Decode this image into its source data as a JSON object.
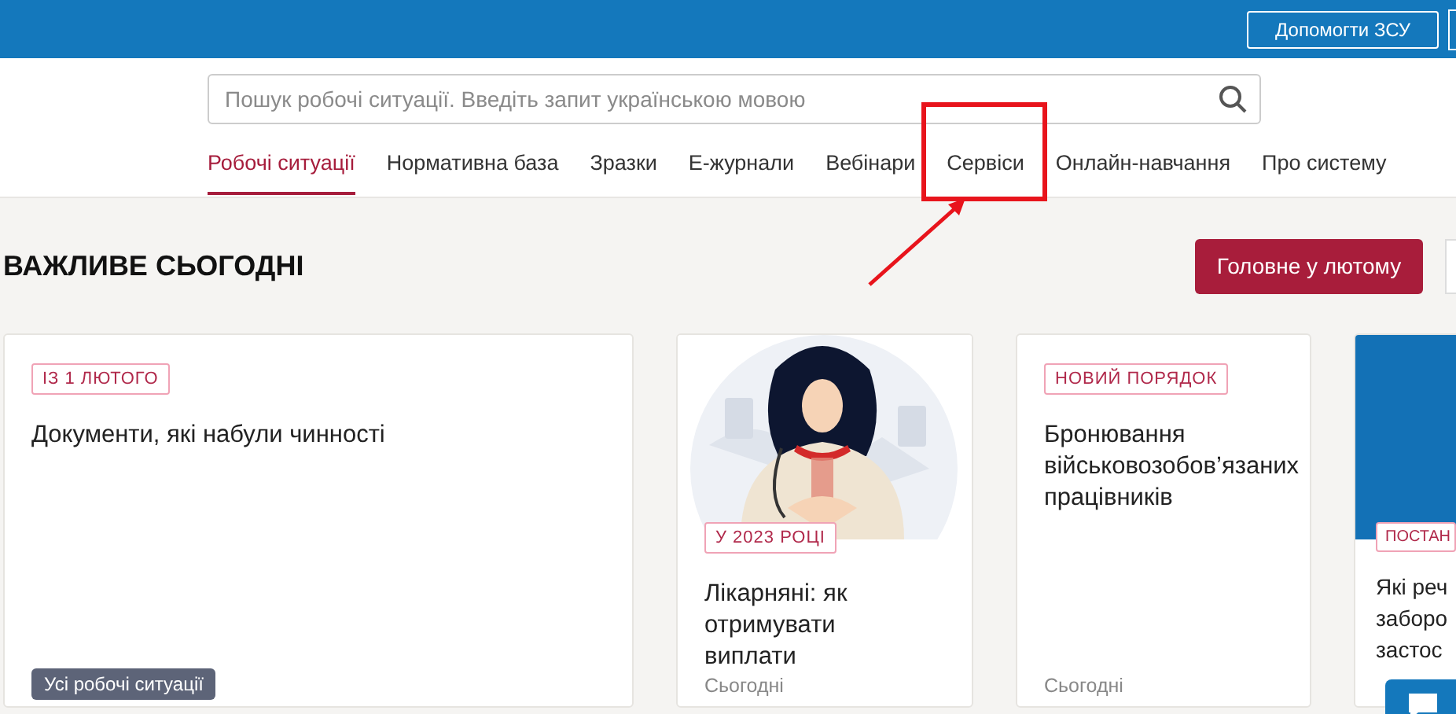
{
  "top_bar": {
    "buttons": [
      "Допомогти ЗСУ"
    ]
  },
  "search": {
    "placeholder": "Пошук робочі ситуації. Введіть запит українською мовою"
  },
  "tabs": [
    {
      "label": "Робочі ситуації",
      "selected": true,
      "highlighted": false
    },
    {
      "label": "Нормативна база",
      "selected": false,
      "highlighted": false
    },
    {
      "label": "Зразки",
      "selected": false,
      "highlighted": false
    },
    {
      "label": "Е-журнали",
      "selected": false,
      "highlighted": false
    },
    {
      "label": "Вебінари",
      "selected": false,
      "highlighted": false
    },
    {
      "label": "Сервіси",
      "selected": false,
      "highlighted": true
    },
    {
      "label": "Онлайн-навчання",
      "selected": false,
      "highlighted": false
    },
    {
      "label": "Про систему",
      "selected": false,
      "highlighted": false
    }
  ],
  "section": {
    "title": "ВАЖЛИВЕ СЬОГОДНІ",
    "button": "Головне у лютому"
  },
  "cards": [
    {
      "kind": "text",
      "tag": "ІЗ 1 ЛЮТОГО",
      "title": "Документи, які набули чинності",
      "button": "Усі робочі ситуації"
    },
    {
      "kind": "picture",
      "tag": "У 2023 РОЦІ",
      "title": "Лікарняні: як отримувати виплати",
      "date": "Сьогодні"
    },
    {
      "kind": "text",
      "tag": "НОВИЙ ПОРЯДОК",
      "title": "Бронювання військовозобов’язаних працівників",
      "date": "Сьогодні"
    },
    {
      "kind": "banner",
      "tag": "ПОСТАН",
      "title_lines": [
        "Які реч",
        "заборо",
        "застос"
      ]
    }
  ]
}
